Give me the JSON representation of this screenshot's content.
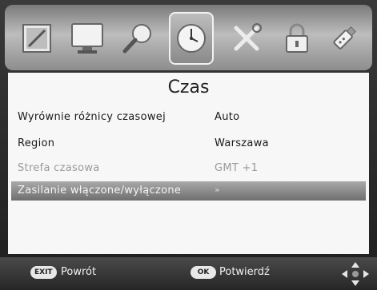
{
  "menu": {
    "icons": [
      "picture-icon",
      "tv-icon",
      "search-icon",
      "clock-icon",
      "tools-icon",
      "lock-icon",
      "usb-icon"
    ],
    "active_icon": "clock-icon"
  },
  "page": {
    "title": "Czas",
    "rows": [
      {
        "label": "Wyrównie różnicy czasowej",
        "value": "Auto",
        "state": "normal"
      },
      {
        "label": "Region",
        "value": "Warszawa",
        "state": "normal"
      },
      {
        "label": "Strefa czasowa",
        "value": "GMT +1",
        "state": "disabled"
      },
      {
        "label": "Zasilanie włączone/wyłączone",
        "value": "»",
        "state": "selected"
      }
    ]
  },
  "footer": {
    "exit_key": "EXIT",
    "exit_label": "Powrót",
    "ok_key": "OK",
    "ok_label": "Potwierdź"
  }
}
